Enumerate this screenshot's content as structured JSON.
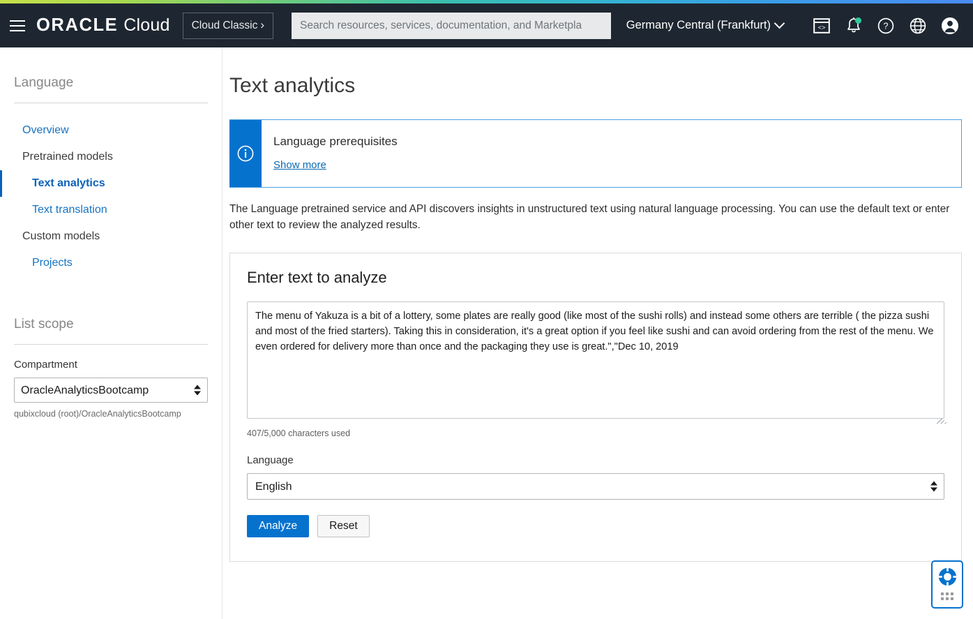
{
  "header": {
    "logo_oracle": "ORACLE",
    "logo_cloud": "Cloud",
    "cloud_classic_label": "Cloud Classic",
    "cloud_classic_chevron": "›",
    "search_placeholder": "Search resources, services, documentation, and Marketpla",
    "search_value": "",
    "region": "Germany Central (Frankfurt)",
    "icons": {
      "menu": "hamburger-icon",
      "developer_tools": "code-window-icon",
      "notifications": "bell-icon",
      "help": "help-circle-icon",
      "language": "globe-icon",
      "profile": "user-avatar-icon"
    },
    "notification_badge": true,
    "colors": {
      "background": "#1e2731",
      "notification_dot": "#2ecc9b"
    }
  },
  "sidebar": {
    "service_title": "Language",
    "nav": [
      {
        "label": "Overview",
        "type": "link",
        "active": false
      },
      {
        "label": "Pretrained models",
        "type": "group",
        "active": false
      },
      {
        "label": "Text analytics",
        "type": "sub",
        "active": true
      },
      {
        "label": "Text translation",
        "type": "sub",
        "active": false
      },
      {
        "label": "Custom models",
        "type": "group",
        "active": false
      },
      {
        "label": "Projects",
        "type": "sub",
        "active": false
      }
    ],
    "list_scope_title": "List scope",
    "compartment_label": "Compartment",
    "compartment_value": "OracleAnalyticsBootcamp",
    "compartment_path": "qubixcloud (root)/OracleAnalyticsBootcamp"
  },
  "main": {
    "page_title": "Text analytics",
    "banner": {
      "icon": "info-circle-icon",
      "title": "Language prerequisites",
      "link_label": "Show more",
      "accent_color": "#0572ce"
    },
    "description": "The Language pretrained service and API discovers insights in unstructured text using natural language processing. You can use the default text or enter other text to review the analyzed results.",
    "card": {
      "title": "Enter text to analyze",
      "textarea_value": "The menu of Yakuza is a bit of a lottery, some plates are really good (like most of the sushi rolls) and instead some others are terrible ( the pizza sushi and most of the fried starters). Taking this in consideration, it's a great option if you feel like sushi and can avoid ordering from the rest of the menu. We even ordered for delivery more than once and the packaging they use is great.\",\"Dec 10, 2019",
      "textarea_placeholder": "",
      "char_count": "407/5,000 characters used",
      "language_label": "Language",
      "language_value": "English",
      "analyze_label": "Analyze",
      "reset_label": "Reset"
    }
  },
  "support_widget": {
    "icon": "life-ring-icon",
    "drag_handle": "dot-grid-icon",
    "accent_color": "#0572ce"
  }
}
